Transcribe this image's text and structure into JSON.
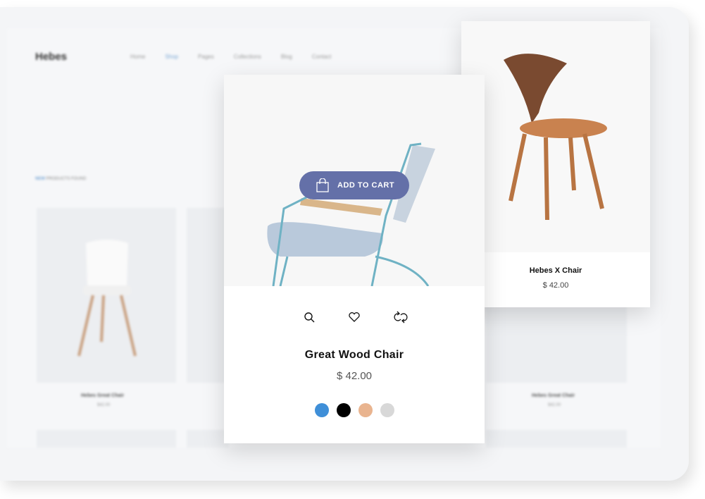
{
  "background_site": {
    "logo": "Hebes",
    "nav": [
      "Home",
      "Shop",
      "Pages",
      "Collections",
      "Blog",
      "Contact"
    ],
    "active_nav": "Shop",
    "section_label_accent": "NEW",
    "section_label": "PRODUCTS FOUND",
    "products": [
      {
        "name": "Hebes Great Chair",
        "price": "$42.00"
      },
      {
        "name": "Hebes Great Chair",
        "price": "$42.00"
      }
    ]
  },
  "featured_card": {
    "add_to_cart": "ADD TO CART",
    "title": "Great Wood Chair",
    "price": "$ 42.00",
    "actions": [
      "search-icon",
      "heart-icon",
      "compare-icon"
    ],
    "swatches": [
      "#3f8fd8",
      "#000000",
      "#e9b48f",
      "#d8d8d8"
    ],
    "accent": "#6470a8"
  },
  "side_card": {
    "title": "Hebes X Chair",
    "price": "$ 42.00"
  }
}
